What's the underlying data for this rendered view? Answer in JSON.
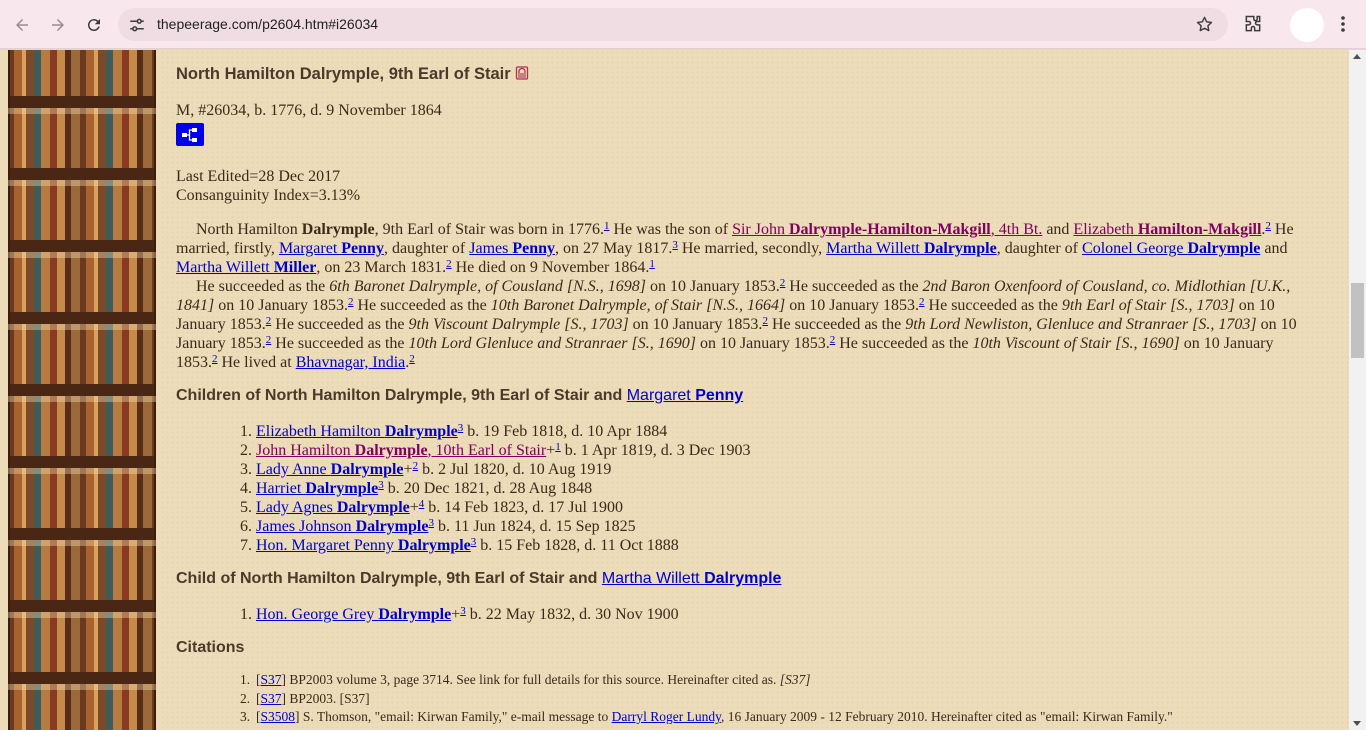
{
  "browser": {
    "url": "thepeerage.com/p2604.htm#i26034"
  },
  "person": {
    "title": "North Hamilton Dalrymple, 9th Earl of Stair",
    "summary": "M, #26034, b. 1776, d. 9 November 1864",
    "last_edited": "Last Edited=28 Dec 2017",
    "consanguinity": "Consanguinity Index=3.13%"
  },
  "bio": {
    "p1": {
      "t1": "North Hamilton ",
      "surname": "Dalrymple",
      "t2": ", 9th Earl of Stair was born in 1776.",
      "c1": "1",
      "t3": " He was the son of ",
      "father_pre": "Sir John ",
      "father_name": "Dalrymple-Hamilton-Makgill",
      "father_post": ", 4th Bt.",
      "t4": " and ",
      "mother_pre": "Elizabeth ",
      "mother_name": "Hamilton-Makgill",
      "mother_post": ".",
      "c2": "2",
      "t5": " He married, firstly, ",
      "wife1_pre": "Margaret ",
      "wife1_name": "Penny",
      "t6": ", daughter of ",
      "wife1father_pre": "James ",
      "wife1father_name": "Penny",
      "t7": ", on 27 May 1817.",
      "c3": "3",
      "t8": " He married, secondly, ",
      "wife2_pre": "Martha Willett ",
      "wife2_name": "Dalrymple",
      "t9": ", daughter of ",
      "wife2father_pre": "Colonel George ",
      "wife2father_name": "Dalrymple",
      "t10": " and ",
      "wife2mother_pre": "Martha Willett ",
      "wife2mother_name": "Miller",
      "t11": ", on 23 March 1831.",
      "c4": "2",
      "t12": " He died on 9 November 1864.",
      "c5": "1"
    },
    "p2": {
      "s1": "He succeeded as the ",
      "i1": "6th Baronet Dalrymple, of Cousland [N.S., 1698]",
      "s2": " on 10 January 1853.",
      "c1": "2",
      "s3": " He succeeded as the ",
      "i2": "2nd Baron Oxenfoord of Cousland, co. Midlothian [U.K., 1841]",
      "s4": " on 10 January 1853.",
      "c2": "2",
      "s5": " He succeeded as the ",
      "i3": "10th Baronet Dalrymple, of Stair [N.S., 1664]",
      "s6": " on 10 January 1853.",
      "c3": "2",
      "s7": " He succeeded as the ",
      "i4": "9th Earl of Stair [S., 1703]",
      "s8": " on 10 January 1853.",
      "c4": "2",
      "s9": " He succeeded as the ",
      "i5": "9th Viscount Dalrymple [S., 1703]",
      "s10": " on 10 January 1853.",
      "c5": "2",
      "s11": " He succeeded as the ",
      "i6": "9th Lord Newliston, Glenluce and Stranraer [S., 1703]",
      "s12": " on 10 January 1853.",
      "c6": "2",
      "s13": " He succeeded as the ",
      "i7": "10th Lord Glenluce and Stranraer [S., 1690]",
      "s14": " on 10 January 1853.",
      "c7": "2",
      "s15": " He succeeded as the ",
      "i8": "10th Viscount of Stair [S., 1690]",
      "s16": " on 10 January 1853.",
      "c8": "2",
      "s17": " He lived at ",
      "place": "Bhavnagar, India",
      "s18": ".",
      "c9": "2"
    }
  },
  "children1": {
    "heading": "Children of North Hamilton Dalrymple, 9th Earl of Stair and ",
    "spouse_pre": "Margaret ",
    "spouse_name": "Penny",
    "items": [
      {
        "num": "1.",
        "pre": "Elizabeth Hamilton ",
        "name": "Dalrymple",
        "post": "",
        "plus": "",
        "cite": "3",
        "dates": " b. 19 Feb 1818, d. 10 Apr 1884"
      },
      {
        "num": "2.",
        "pre": "John Hamilton ",
        "name": "Dalrymple",
        "post": ", 10th Earl of Stair",
        "plus": "+",
        "cite": "1",
        "dates": " b. 1 Apr 1819, d. 3 Dec 1903"
      },
      {
        "num": "3.",
        "pre": "Lady Anne ",
        "name": "Dalrymple",
        "post": "",
        "plus": "+",
        "cite": "2",
        "dates": " b. 2 Jul 1820, d. 10 Aug 1919"
      },
      {
        "num": "4.",
        "pre": "Harriet ",
        "name": "Dalrymple",
        "post": "",
        "plus": "",
        "cite": "3",
        "dates": " b. 20 Dec 1821, d. 28 Aug 1848"
      },
      {
        "num": "5.",
        "pre": "Lady Agnes ",
        "name": "Dalrymple",
        "post": "",
        "plus": "+",
        "cite": "4",
        "dates": " b. 14 Feb 1823, d. 17 Jul 1900"
      },
      {
        "num": "6.",
        "pre": "James Johnson ",
        "name": "Dalrymple",
        "post": "",
        "plus": "",
        "cite": "3",
        "dates": " b. 11 Jun 1824, d. 15 Sep 1825"
      },
      {
        "num": "7.",
        "pre": "Hon. Margaret Penny ",
        "name": "Dalrymple",
        "post": "",
        "plus": "",
        "cite": "3",
        "dates": " b. 15 Feb 1828, d. 11 Oct 1888"
      }
    ]
  },
  "children2": {
    "heading": "Child of North Hamilton Dalrymple, 9th Earl of Stair and ",
    "spouse_pre": "Martha Willett ",
    "spouse_name": "Dalrymple",
    "items": [
      {
        "num": "1.",
        "pre": "Hon. George Grey ",
        "name": "Dalrymple",
        "post": "",
        "plus": "+",
        "cite": "3",
        "dates": " b. 22 May 1832, d. 30 Nov 1900"
      }
    ]
  },
  "citations": {
    "heading": "Citations",
    "items": [
      {
        "num": "1.",
        "open": "[",
        "code": "S37",
        "close": "]",
        "text": " BP2003 volume 3, page 3714. See link for full details for this source. Hereinafter cited as. ",
        "ital": "[S37]",
        "link2": "",
        "text2": ""
      },
      {
        "num": "2.",
        "open": "[",
        "code": "S37",
        "close": "]",
        "text": " BP2003. [S37]",
        "ital": "",
        "link2": "",
        "text2": ""
      },
      {
        "num": "3.",
        "open": "[",
        "code": "S3508",
        "close": "]",
        "text": " S. Thomson, \"email: Kirwan Family,\" e-mail message to ",
        "ital": "",
        "link2": "Darryl Roger Lundy",
        "text2": ", 16 January 2009 - 12 February 2010. Hereinafter cited as \"email: Kirwan Family.\""
      }
    ]
  }
}
